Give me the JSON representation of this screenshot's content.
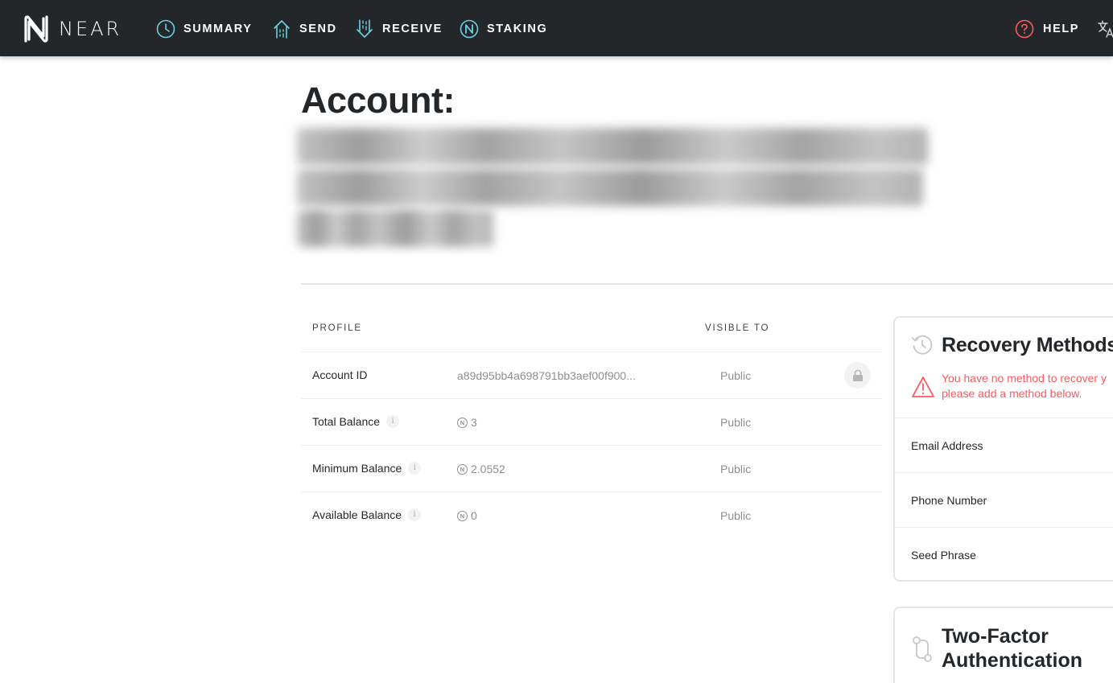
{
  "nav": {
    "brand": "NEAR",
    "items": [
      {
        "label": "SUMMARY",
        "icon": "clock-icon"
      },
      {
        "label": "SEND",
        "icon": "send-arrow-icon"
      },
      {
        "label": "RECEIVE",
        "icon": "receive-arrow-icon"
      },
      {
        "label": "STAKING",
        "icon": "near-coin-icon"
      }
    ],
    "help": "HELP",
    "language_icon": "translate-icon"
  },
  "page": {
    "title": "Account:"
  },
  "profile": {
    "headers": {
      "profile": "PROFILE",
      "visible_to": "VISIBLE TO"
    },
    "rows": [
      {
        "label": "Account ID",
        "value": "a89d95bb4a698791bb3aef00f900...",
        "visible": "Public",
        "has_info": false,
        "near_symbol": false
      },
      {
        "label": "Total Balance",
        "value": "3",
        "visible": "Public",
        "has_info": true,
        "near_symbol": true
      },
      {
        "label": "Minimum Balance",
        "value": "2.0552",
        "visible": "Public",
        "has_info": true,
        "near_symbol": true
      },
      {
        "label": "Available Balance",
        "value": "0",
        "visible": "Public",
        "has_info": true,
        "near_symbol": true
      }
    ]
  },
  "recovery": {
    "title": "Recovery Methods",
    "warning_line1": "You have no method to recover y",
    "warning_line2": "please add a method below.",
    "methods": [
      "Email Address",
      "Phone Number",
      "Seed Phrase"
    ]
  },
  "two_factor": {
    "title_line1": "Two-Factor",
    "title_line2": "Authentication"
  },
  "colors": {
    "nav_bg": "#24272a",
    "accent": "#6ad1e3",
    "warning": "#ff585d",
    "muted": "#8c8f94"
  }
}
